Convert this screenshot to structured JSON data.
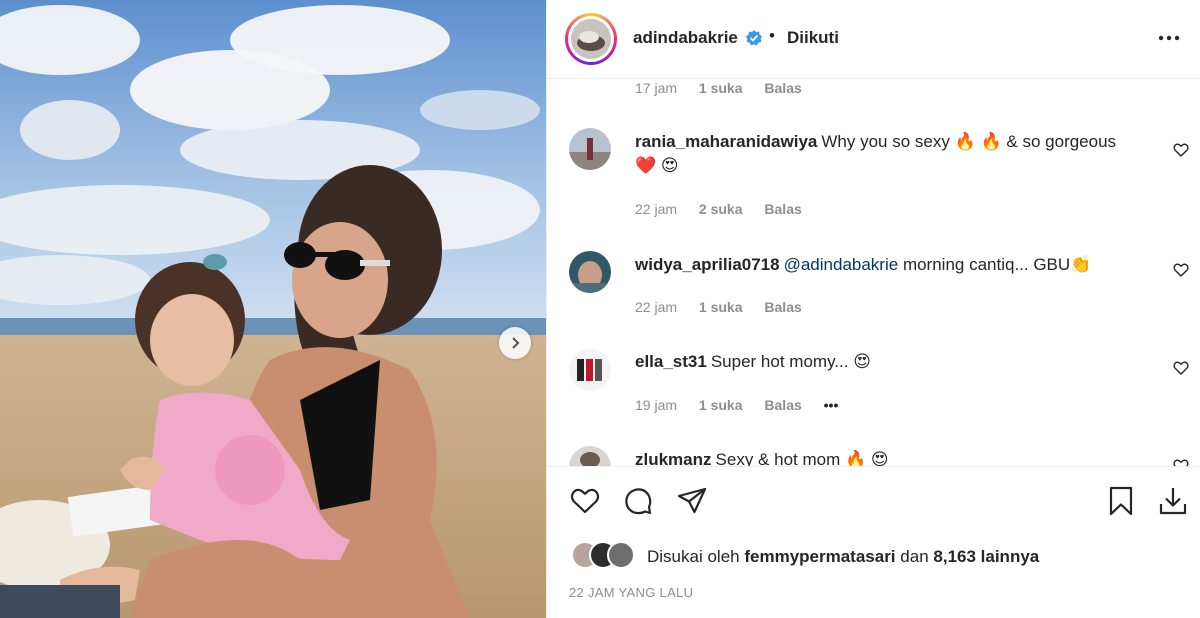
{
  "post": {
    "username": "adindabakrie",
    "separator": "•",
    "follow_status": "Diikuti",
    "more_icon": "more-horizontal-icon",
    "verified_icon": "verified-badge-icon"
  },
  "comments": [
    {
      "time": "17 jam",
      "likes": "1 suka",
      "reply": "Balas"
    },
    {
      "username": "rania_maharanidawiya",
      "text": "Why you so sexy",
      "emoji1": "🔥",
      "emoji2": "🔥",
      "text2": "& so gorgeous",
      "emoji3": "❤️",
      "emoji4": "😍",
      "time": "22 jam",
      "likes": "2 suka",
      "reply": "Balas"
    },
    {
      "username": "widya_aprilia0718",
      "mention": "@adindabakrie",
      "text": "morning cantiq... GBU",
      "emoji1": "👏",
      "time": "22 jam",
      "likes": "1 suka",
      "reply": "Balas"
    },
    {
      "username": "ella_st31",
      "text": "Super hot momy...",
      "emoji1": "😍",
      "time": "19 jam",
      "likes": "1 suka",
      "reply": "Balas",
      "more": "•••"
    },
    {
      "username": "zlukmanz",
      "text": "Sexy & hot mom",
      "emoji1": "🔥",
      "emoji2": "😍"
    }
  ],
  "actions": {
    "like_icon": "heart-icon",
    "comment_icon": "comment-icon",
    "share_icon": "share-icon",
    "save_icon": "bookmark-icon",
    "download_icon": "download-icon"
  },
  "likes": {
    "prefix": "Disukai oleh",
    "user": "femmypermatasari",
    "middle": "dan",
    "count": "8,163 lainnya"
  },
  "timestamp": "22 JAM YANG LALU"
}
